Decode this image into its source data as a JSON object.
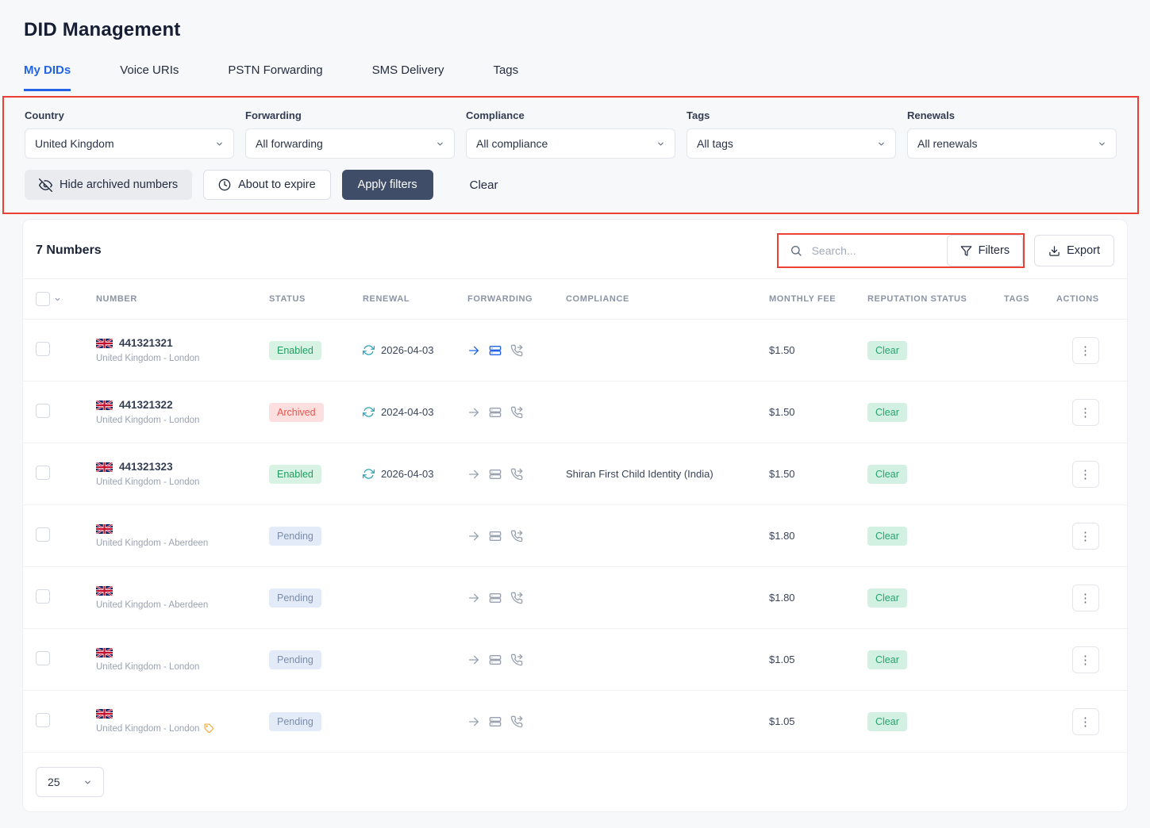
{
  "page_title": "DID Management",
  "tabs": [
    {
      "label": "My DIDs",
      "active": true
    },
    {
      "label": "Voice URIs",
      "active": false
    },
    {
      "label": "PSTN Forwarding",
      "active": false
    },
    {
      "label": "SMS Delivery",
      "active": false
    },
    {
      "label": "Tags",
      "active": false
    }
  ],
  "filters": {
    "fields": [
      {
        "label": "Country",
        "value": "United Kingdom"
      },
      {
        "label": "Forwarding",
        "value": "All forwarding"
      },
      {
        "label": "Compliance",
        "value": "All compliance"
      },
      {
        "label": "Tags",
        "value": "All tags"
      },
      {
        "label": "Renewals",
        "value": "All renewals"
      }
    ],
    "hide_archived_label": "Hide archived numbers",
    "about_to_expire_label": "About to expire",
    "apply_label": "Apply filters",
    "clear_label": "Clear"
  },
  "toolbar": {
    "count_label": "7 Numbers",
    "search_placeholder": "Search...",
    "filters_label": "Filters",
    "export_label": "Export"
  },
  "table": {
    "headers": {
      "number": "NUMBER",
      "status": "STATUS",
      "renewal": "RENEWAL",
      "forwarding": "FORWARDING",
      "compliance": "COMPLIANCE",
      "fee": "MONTHLY FEE",
      "reputation": "REPUTATION STATUS",
      "tags": "TAGS",
      "actions": "ACTIONS"
    },
    "rows": [
      {
        "number": "441321321",
        "location": "United Kingdom - London",
        "status": "Enabled",
        "renewal": "2026-04-03",
        "compliance": "",
        "fee": "$1.50",
        "reputation": "Clear",
        "forwarding_active": true,
        "tag_icon": false
      },
      {
        "number": "441321322",
        "location": "United Kingdom - London",
        "status": "Archived",
        "renewal": "2024-04-03",
        "compliance": "",
        "fee": "$1.50",
        "reputation": "Clear",
        "forwarding_active": false,
        "tag_icon": false
      },
      {
        "number": "441321323",
        "location": "United Kingdom - London",
        "status": "Enabled",
        "renewal": "2026-04-03",
        "compliance": "Shiran First Child Identity (India)",
        "fee": "$1.50",
        "reputation": "Clear",
        "forwarding_active": false,
        "tag_icon": false
      },
      {
        "number": "",
        "location": "United Kingdom - Aberdeen",
        "status": "Pending",
        "renewal": "",
        "compliance": "",
        "fee": "$1.80",
        "reputation": "Clear",
        "forwarding_active": false,
        "tag_icon": false
      },
      {
        "number": "",
        "location": "United Kingdom - Aberdeen",
        "status": "Pending",
        "renewal": "",
        "compliance": "",
        "fee": "$1.80",
        "reputation": "Clear",
        "forwarding_active": false,
        "tag_icon": false
      },
      {
        "number": "",
        "location": "United Kingdom - London",
        "status": "Pending",
        "renewal": "",
        "compliance": "",
        "fee": "$1.05",
        "reputation": "Clear",
        "forwarding_active": false,
        "tag_icon": false
      },
      {
        "number": "",
        "location": "United Kingdom - London",
        "status": "Pending",
        "renewal": "",
        "compliance": "",
        "fee": "$1.05",
        "reputation": "Clear",
        "forwarding_active": false,
        "tag_icon": true
      }
    ]
  },
  "pagination": {
    "page_size": "25"
  },
  "icons": {
    "hide_archived": "eye-off-icon",
    "about_to_expire": "clock-icon",
    "search": "search-icon",
    "filters": "funnel-icon",
    "export": "download-icon",
    "renewal": "refresh-icon",
    "forwarding": [
      "arrow-right-icon",
      "sip-trunk-icon",
      "phone-forward-icon"
    ],
    "actions": "kebab-menu-icon",
    "flag": "uk-flag-icon",
    "tag": "tag-icon"
  },
  "colors": {
    "accent_blue": "#2264e5",
    "apply_button": "#3f4d68",
    "annotation_red": "#ec4034",
    "status_enabled_text": "#1e9e63",
    "status_enabled_bg": "#d8f3e3",
    "status_archived_text": "#e4564e",
    "status_archived_bg": "#fcdfde",
    "status_pending_text": "#7b8dab",
    "status_pending_bg": "#e4ebf8",
    "reputation_clear_text": "#27a36d",
    "reputation_clear_bg": "#d3f1e2",
    "refresh_icon": "#2da4bf",
    "tag_icon_color": "#f0a93c"
  }
}
